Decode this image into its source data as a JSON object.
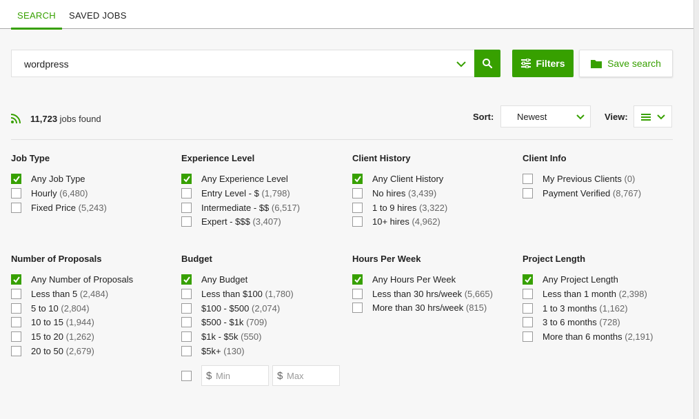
{
  "tabs": [
    {
      "label": "SEARCH",
      "active": true
    },
    {
      "label": "SAVED JOBS",
      "active": false
    }
  ],
  "search": {
    "value": "wordpress"
  },
  "buttons": {
    "filters": "Filters",
    "save_search": "Save search"
  },
  "results": {
    "count": "11,723",
    "suffix": "jobs found"
  },
  "sort": {
    "label": "Sort:",
    "value": "Newest"
  },
  "view": {
    "label": "View:"
  },
  "colors": {
    "accent": "#37a000",
    "background": "#f7f7f7"
  },
  "filters": {
    "job_type": {
      "title": "Job Type",
      "options": [
        {
          "label": "Any Job Type",
          "count": "",
          "checked": true
        },
        {
          "label": "Hourly",
          "count": "(6,480)",
          "checked": false
        },
        {
          "label": "Fixed Price",
          "count": "(5,243)",
          "checked": false
        }
      ]
    },
    "experience": {
      "title": "Experience Level",
      "options": [
        {
          "label": "Any Experience Level",
          "count": "",
          "checked": true
        },
        {
          "label": "Entry Level - $",
          "count": "(1,798)",
          "checked": false
        },
        {
          "label": "Intermediate - $$",
          "count": "(6,517)",
          "checked": false
        },
        {
          "label": "Expert - $$$",
          "count": "(3,407)",
          "checked": false
        }
      ]
    },
    "client_history": {
      "title": "Client History",
      "options": [
        {
          "label": "Any Client History",
          "count": "",
          "checked": true
        },
        {
          "label": "No hires",
          "count": "(3,439)",
          "checked": false
        },
        {
          "label": "1 to 9 hires",
          "count": "(3,322)",
          "checked": false
        },
        {
          "label": "10+ hires",
          "count": "(4,962)",
          "checked": false
        }
      ]
    },
    "client_info": {
      "title": "Client Info",
      "options": [
        {
          "label": "My Previous Clients",
          "count": "(0)",
          "checked": false
        },
        {
          "label": "Payment Verified",
          "count": "(8,767)",
          "checked": false
        }
      ]
    },
    "proposals": {
      "title": "Number of Proposals",
      "options": [
        {
          "label": "Any Number of Proposals",
          "count": "",
          "checked": true
        },
        {
          "label": "Less than 5",
          "count": "(2,484)",
          "checked": false
        },
        {
          "label": "5 to 10",
          "count": "(2,804)",
          "checked": false
        },
        {
          "label": "10 to 15",
          "count": "(1,944)",
          "checked": false
        },
        {
          "label": "15 to 20",
          "count": "(1,262)",
          "checked": false
        },
        {
          "label": "20 to 50",
          "count": "(2,679)",
          "checked": false
        }
      ]
    },
    "budget": {
      "title": "Budget",
      "options": [
        {
          "label": "Any Budget",
          "count": "",
          "checked": true
        },
        {
          "label": "Less than $100",
          "count": "(1,780)",
          "checked": false
        },
        {
          "label": "$100 - $500",
          "count": "(2,074)",
          "checked": false
        },
        {
          "label": "$500 - $1k",
          "count": "(709)",
          "checked": false
        },
        {
          "label": "$1k - $5k",
          "count": "(550)",
          "checked": false
        },
        {
          "label": "$5k+",
          "count": "(130)",
          "checked": false
        }
      ],
      "custom": {
        "currency": "$",
        "min_placeholder": "Min",
        "max_placeholder": "Max"
      }
    },
    "hours": {
      "title": "Hours Per Week",
      "options": [
        {
          "label": "Any Hours Per Week",
          "count": "",
          "checked": true
        },
        {
          "label": "Less than 30 hrs/week",
          "count": "(5,665)",
          "checked": false
        },
        {
          "label": "More than 30 hrs/week",
          "count": "(815)",
          "checked": false
        }
      ]
    },
    "project_length": {
      "title": "Project Length",
      "options": [
        {
          "label": "Any Project Length",
          "count": "",
          "checked": true
        },
        {
          "label": "Less than 1 month",
          "count": "(2,398)",
          "checked": false
        },
        {
          "label": "1 to 3 months",
          "count": "(1,162)",
          "checked": false
        },
        {
          "label": "3 to 6 months",
          "count": "(728)",
          "checked": false
        },
        {
          "label": "More than 6 months",
          "count": "(2,191)",
          "checked": false
        }
      ]
    }
  }
}
